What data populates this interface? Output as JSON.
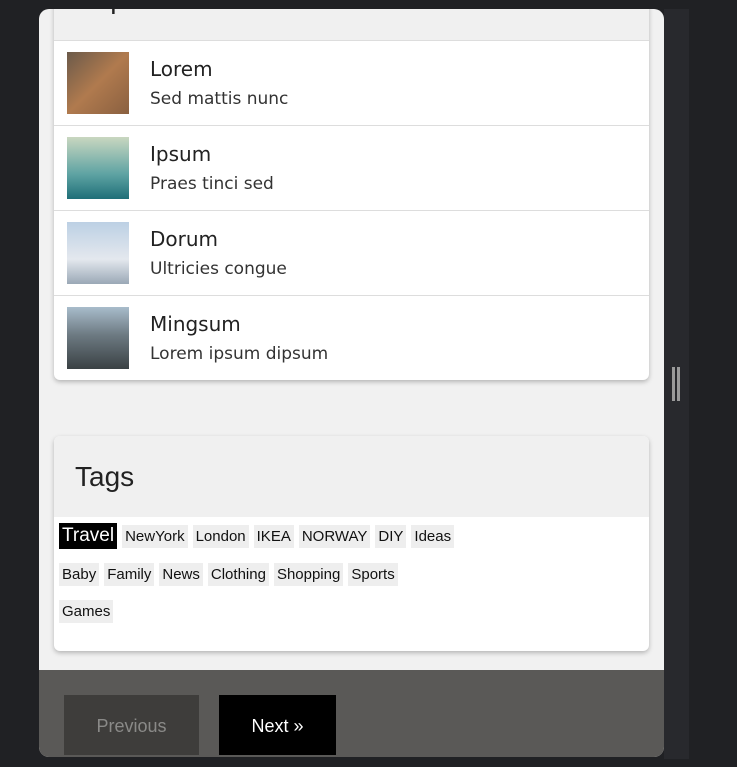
{
  "popular_posts": {
    "title": "Popular Posts",
    "items": [
      {
        "title": "Lorem",
        "subtitle": "Sed mattis nunc"
      },
      {
        "title": "Ipsum",
        "subtitle": "Praes tinci sed"
      },
      {
        "title": "Dorum",
        "subtitle": "Ultricies congue"
      },
      {
        "title": "Mingsum",
        "subtitle": "Lorem ipsum dipsum"
      }
    ]
  },
  "tags": {
    "title": "Tags",
    "active": "Travel",
    "items": [
      "Travel",
      "NewYork",
      "London",
      "IKEA",
      "NORWAY",
      "DIY",
      "Ideas",
      "Baby",
      "Family",
      "News",
      "Clothing",
      "Shopping",
      "Sports",
      "Games"
    ]
  },
  "pagination": {
    "previous": "Previous",
    "next": "Next »"
  }
}
